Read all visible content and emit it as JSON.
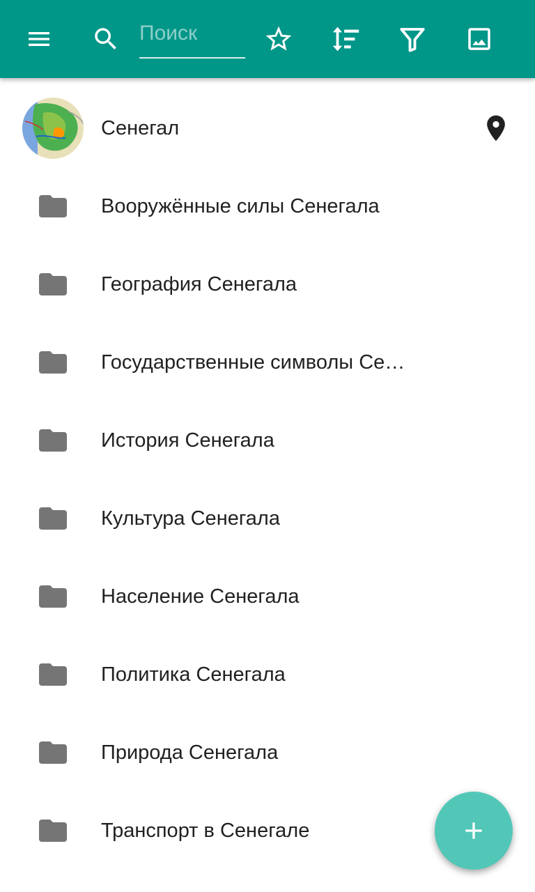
{
  "toolbar": {
    "background_color": "#009688",
    "menu_icon": "menu-icon",
    "search_icon": "search-icon",
    "search_placeholder": "Поиск",
    "search_value": "",
    "actions": [
      {
        "icon": "star-outline-icon"
      },
      {
        "icon": "sort-icon"
      },
      {
        "icon": "filter-icon"
      },
      {
        "icon": "image-icon"
      }
    ]
  },
  "header_item": {
    "label": "Сенегал",
    "thumbnail": "senegal-map-thumbnail",
    "trailing_icon": "map-pin-icon"
  },
  "categories": [
    {
      "label": "Вооружённые силы Сенегала",
      "icon": "folder-icon"
    },
    {
      "label": "География Сенегала",
      "icon": "folder-icon"
    },
    {
      "label": "Государственные символы Се…",
      "icon": "folder-icon"
    },
    {
      "label": "История Сенегала",
      "icon": "folder-icon"
    },
    {
      "label": "Культура Сенегала",
      "icon": "folder-icon"
    },
    {
      "label": "Население Сенегала",
      "icon": "folder-icon"
    },
    {
      "label": "Политика Сенегала",
      "icon": "folder-icon"
    },
    {
      "label": "Природа Сенегала",
      "icon": "folder-icon"
    },
    {
      "label": "Транспорт в Сенегале",
      "icon": "folder-icon"
    }
  ],
  "fab": {
    "icon": "add-icon",
    "color": "#52c7b8"
  }
}
